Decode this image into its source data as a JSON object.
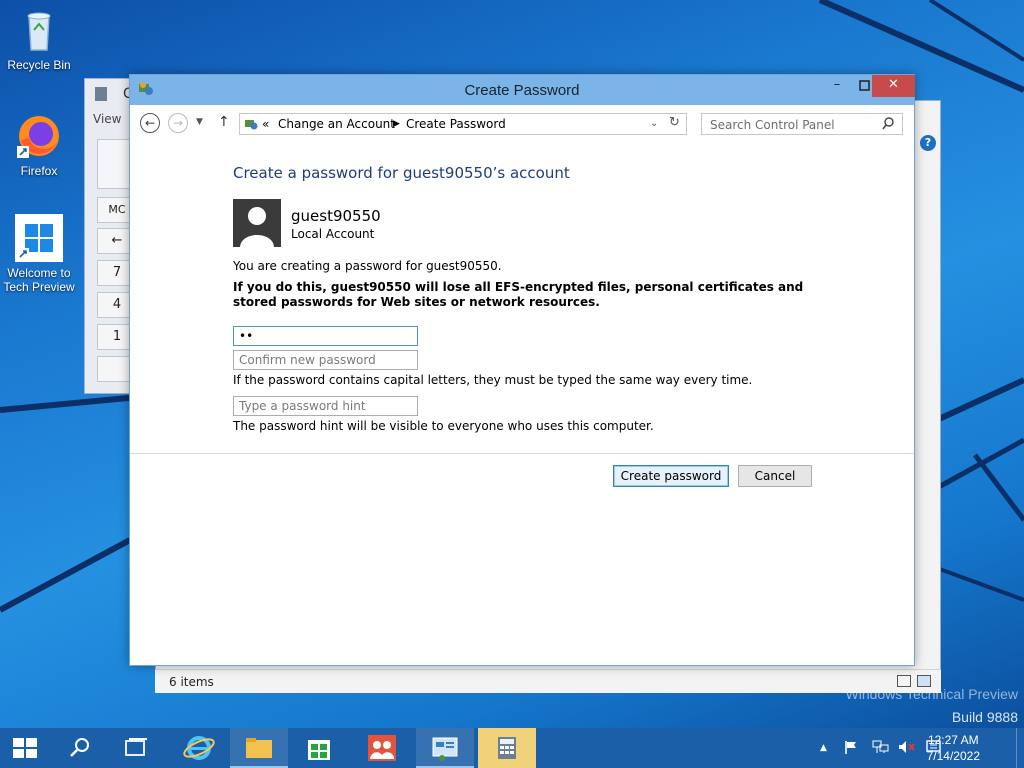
{
  "desktop": {
    "icons": [
      {
        "label": "Recycle Bin"
      },
      {
        "label": "Firefox"
      },
      {
        "label": "Welcome to Tech Preview"
      }
    ],
    "watermark": {
      "line1": "Windows Technical Preview",
      "line2": "Build 9888"
    }
  },
  "calculator": {
    "title": "C",
    "menu": "View",
    "buttons": [
      "MC",
      "←",
      "7",
      "4",
      "1"
    ]
  },
  "dialog": {
    "title": "Create Password",
    "address": {
      "prefix": "«",
      "crumb1": "Change an Account",
      "crumb2": "Create Password"
    },
    "search_placeholder": "Search Control Panel",
    "heading": "Create a password for guest90550’s account",
    "user": {
      "name": "guest90550",
      "type": "Local Account"
    },
    "info": "You are creating a password for guest90550.",
    "warning": "If you do this, guest90550 will lose all EFS-encrypted files, personal certificates and stored passwords for Web sites or network resources.",
    "password_value": "12",
    "confirm_placeholder": "Confirm new password",
    "caps_note": "If the password contains capital letters, they must be typed the same way every time.",
    "hint_placeholder": "Type a password hint",
    "hint_note": "The password hint will be visible to everyone who uses this computer.",
    "create_button": "Create password",
    "cancel_button": "Cancel"
  },
  "statusbar": {
    "items": "6 items"
  },
  "taskbar": {
    "clock_time": "12:27 AM",
    "clock_date": "7/14/2022"
  },
  "colors": {
    "accent": "#7ab4e8",
    "heading": "#1e3d7a",
    "taskbar": "#1b5fa8"
  }
}
